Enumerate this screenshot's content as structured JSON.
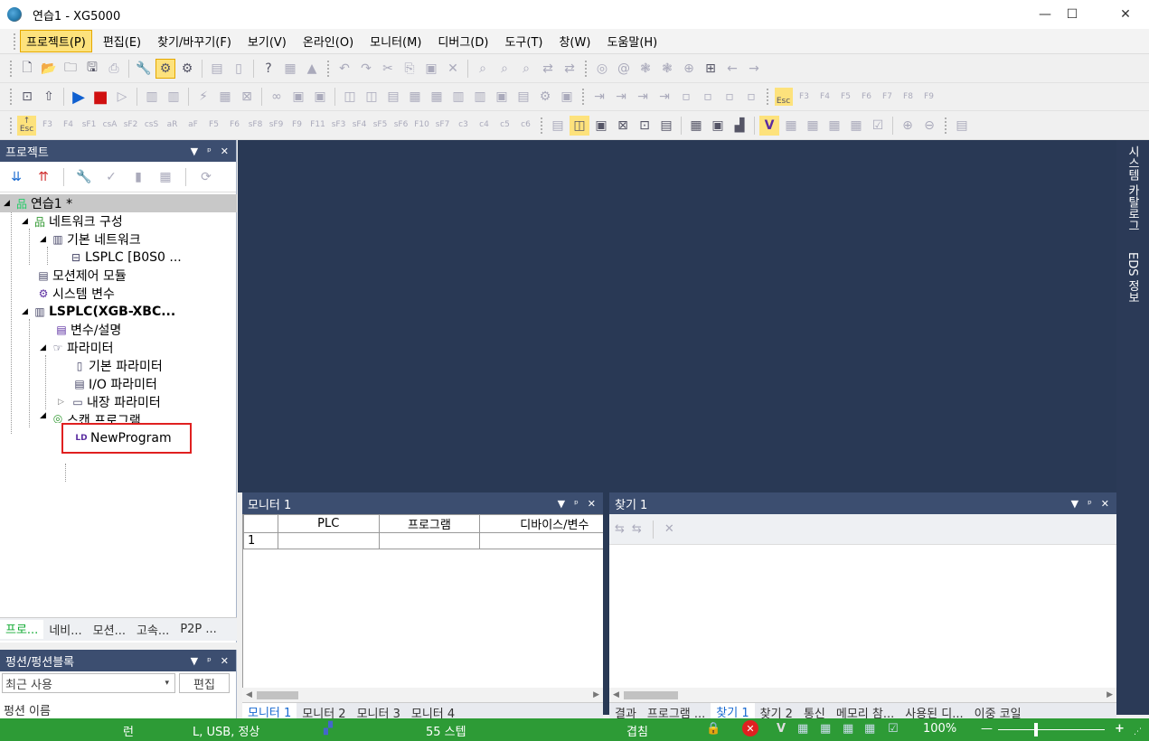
{
  "window": {
    "title": "연습1 - XG5000",
    "minimize": "—",
    "maximize": "☐",
    "close": "✕"
  },
  "menu": [
    "프로젝트(P)",
    "편집(E)",
    "찾기/바꾸기(F)",
    "보기(V)",
    "온라인(O)",
    "모니터(M)",
    "디버그(D)",
    "도구(T)",
    "창(W)",
    "도움말(H)"
  ],
  "fkeys": [
    {
      "top": "↑",
      "bottom": "Esc"
    },
    {
      "top": "",
      "bottom": "F3"
    },
    {
      "top": "",
      "bottom": "F4"
    },
    {
      "top": "",
      "bottom": "sF1"
    },
    {
      "top": "",
      "bottom": "csA"
    },
    {
      "top": "",
      "bottom": "sF2"
    },
    {
      "top": "",
      "bottom": "csS"
    },
    {
      "top": "",
      "bottom": "aR"
    },
    {
      "top": "",
      "bottom": "aF"
    },
    {
      "top": "",
      "bottom": "F5"
    },
    {
      "top": "",
      "bottom": "F6"
    },
    {
      "top": "",
      "bottom": "sF8"
    },
    {
      "top": "",
      "bottom": "sF9"
    },
    {
      "top": "",
      "bottom": "F9"
    },
    {
      "top": "",
      "bottom": "F11"
    },
    {
      "top": "",
      "bottom": "sF3"
    },
    {
      "top": "",
      "bottom": "sF4"
    },
    {
      "top": "",
      "bottom": "sF5"
    },
    {
      "top": "",
      "bottom": "sF6"
    },
    {
      "top": "",
      "bottom": "F10"
    },
    {
      "top": "",
      "bottom": "sF7"
    },
    {
      "top": "",
      "bottom": "c3"
    },
    {
      "top": "",
      "bottom": "c4"
    },
    {
      "top": "",
      "bottom": "c5"
    },
    {
      "top": "",
      "bottom": "c6"
    }
  ],
  "fkeys2": [
    {
      "top": "",
      "bottom": "Esc"
    },
    {
      "top": "",
      "bottom": "F3"
    },
    {
      "top": "",
      "bottom": "F4"
    },
    {
      "top": "",
      "bottom": "F5"
    },
    {
      "top": "",
      "bottom": "F6"
    },
    {
      "top": "",
      "bottom": "F7"
    },
    {
      "top": "",
      "bottom": "F8"
    },
    {
      "top": "",
      "bottom": "F9"
    }
  ],
  "project_panel": {
    "title": "프로젝트",
    "tree": [
      {
        "label": "연습1 *",
        "bold": false,
        "icon": "project-icon"
      },
      {
        "label": "네트워크 구성",
        "bold": false,
        "icon": "network-icon"
      },
      {
        "label": "기본 네트워크",
        "bold": false,
        "icon": "basic-network-icon"
      },
      {
        "label": "LSPLC [B0S0 ...",
        "bold": false,
        "icon": "plc-icon"
      },
      {
        "label": "모션제어 모듈",
        "bold": false,
        "icon": "motion-module-icon"
      },
      {
        "label": "시스템 변수",
        "bold": false,
        "icon": "system-variable-icon"
      },
      {
        "label": "LSPLC(XGB-XBC...",
        "bold": true,
        "icon": "plc-cpu-icon"
      },
      {
        "label": "변수/설명",
        "bold": false,
        "icon": "variable-icon"
      },
      {
        "label": "파라미터",
        "bold": false,
        "icon": "parameter-icon"
      },
      {
        "label": "기본 파라미터",
        "bold": false,
        "icon": "basic-parameter-icon"
      },
      {
        "label": "I/O 파라미터",
        "bold": false,
        "icon": "io-parameter-icon"
      },
      {
        "label": "내장 파라미터",
        "bold": false,
        "icon": "builtin-parameter-icon"
      },
      {
        "label": "스캔 프로그램",
        "bold": false,
        "icon": "scan-program-icon"
      },
      {
        "label": "NewProgram",
        "bold": false,
        "icon": "ld-program-icon"
      }
    ],
    "tabs": [
      "프로...",
      "네비...",
      "모션...",
      "고속...",
      "P2P ..."
    ]
  },
  "function_panel": {
    "title": "펑션/펑션블록",
    "recent": "최근 사용",
    "edit": "편집",
    "partial": "펑션 이름"
  },
  "monitor_panel": {
    "title": "모니터 1",
    "columns": [
      "",
      "PLC",
      "프로그램",
      "디바이스/변수"
    ],
    "rows": [
      [
        "1",
        "",
        "",
        ""
      ]
    ],
    "tabs": [
      "모니터 1",
      "모니터 2",
      "모니터 3",
      "모니터 4"
    ]
  },
  "find_panel": {
    "title": "찾기 1",
    "tabs": [
      "결과",
      "프로그램 ...",
      "찾기 1",
      "찾기 2",
      "통신",
      "메모리 참...",
      "사용된 디...",
      "이중 코일"
    ]
  },
  "right_sidebar": [
    "시스템 카탈로그",
    "EDS 정보"
  ],
  "status": {
    "mode": "런",
    "connection": "L, USB, 정상",
    "steps": "55 스텝",
    "overwrite": "겹침",
    "zoom": "100%"
  },
  "colors": {
    "panel_header": "#3c4e70",
    "mdi_bg": "#293955",
    "status_green": "#2d9b36",
    "highlight_red": "#e02020"
  }
}
